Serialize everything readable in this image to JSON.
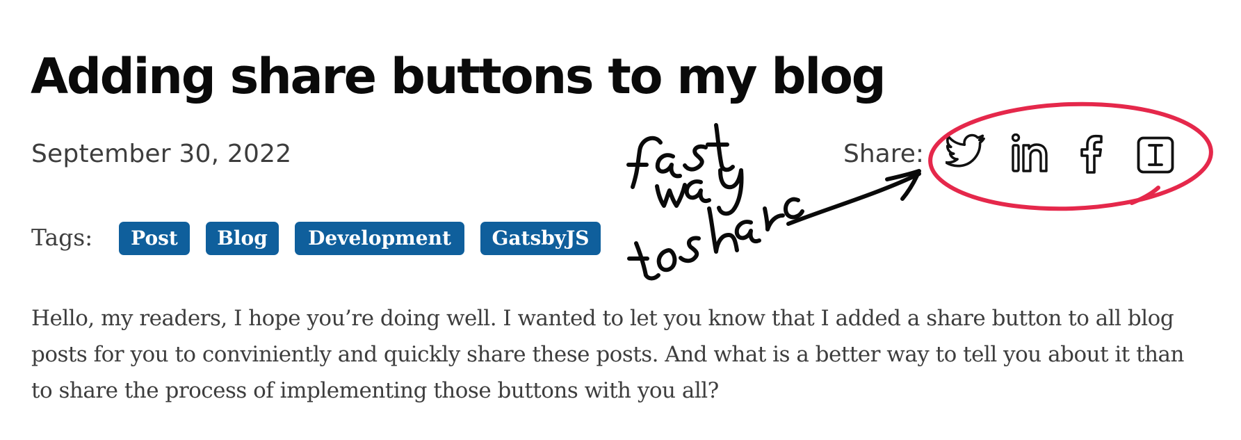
{
  "post": {
    "title": "Adding share buttons to my blog",
    "date": "September 30, 2022",
    "share_label": "Share:",
    "share_buttons": [
      {
        "icon": "twitter-icon"
      },
      {
        "icon": "linkedin-icon"
      },
      {
        "icon": "facebook-icon"
      },
      {
        "icon": "instapaper-icon"
      }
    ],
    "tags_label": "Tags:",
    "tags": [
      "Post",
      "Blog",
      "Development",
      "GatsbyJS"
    ],
    "intro_lines": [
      "Hello, my readers, I hope you’re doing well. I wanted to let you know that I added a share button to all blog",
      "posts for you to conviniently and quickly share these posts. And what is a better way to tell you about it than",
      "to share the process of implementing those buttons with you all?"
    ]
  },
  "annotation": {
    "text": "fast way to share",
    "color": "#e5284b"
  },
  "colors": {
    "tag_background": "#0f5f9c",
    "text": "#3d3d3d",
    "title": "#0a0a0a"
  }
}
